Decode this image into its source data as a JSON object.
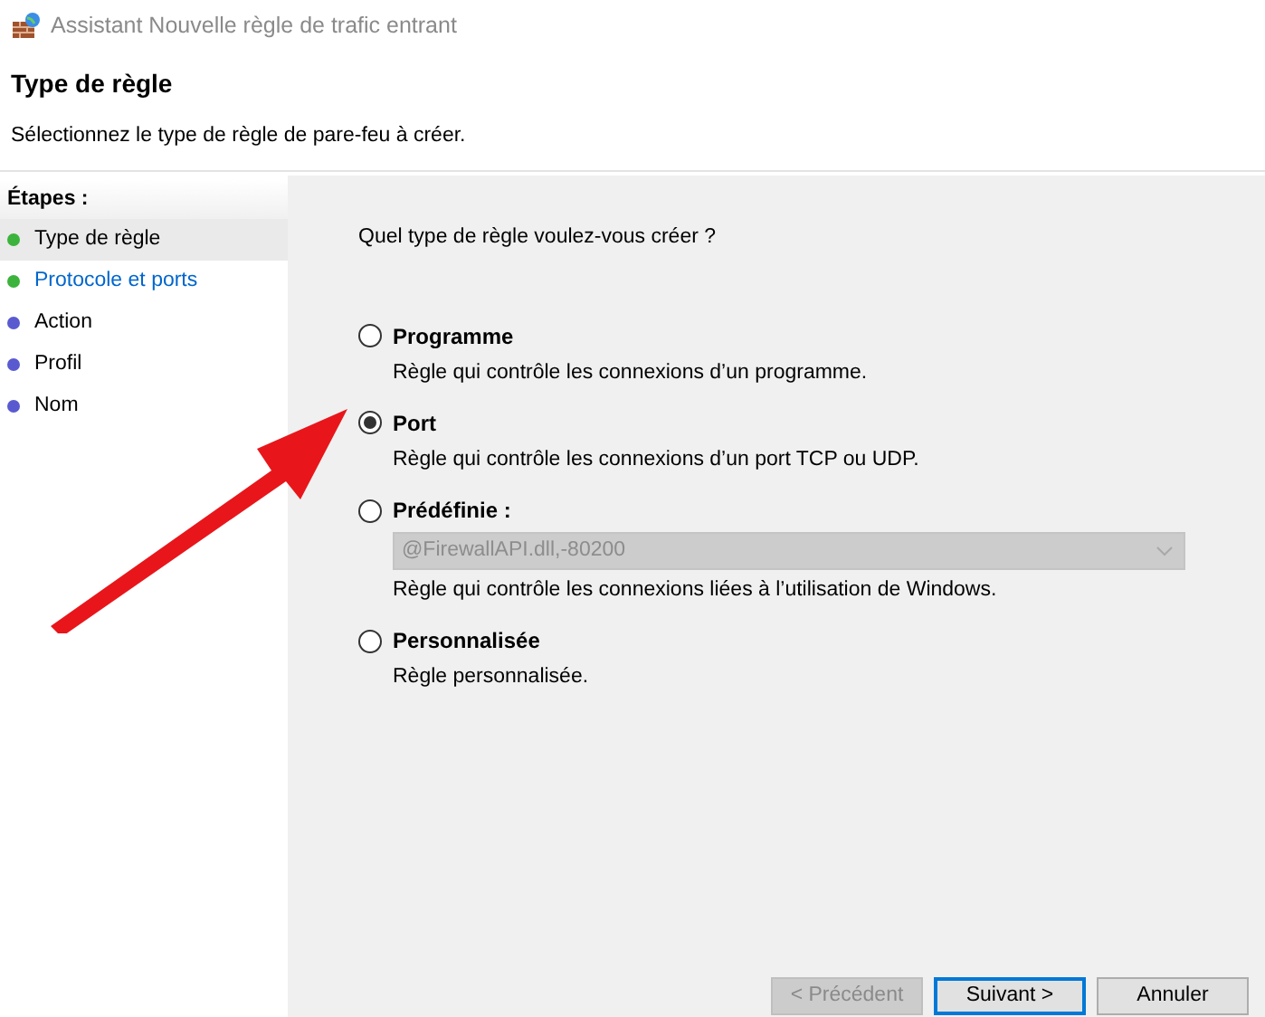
{
  "window": {
    "title": "Assistant Nouvelle règle de trafic entrant"
  },
  "header": {
    "title": "Type de règle",
    "subtitle": "Sélectionnez le type de règle de pare-feu à créer."
  },
  "steps": {
    "heading": "Étapes :",
    "items": [
      {
        "label": "Type de règle",
        "selected": true,
        "kind": "plain",
        "color": "#3cb33c"
      },
      {
        "label": "Protocole et ports",
        "selected": false,
        "kind": "link",
        "color": "#3cb33c"
      },
      {
        "label": "Action",
        "selected": false,
        "kind": "plain",
        "color": "#5a5ad0"
      },
      {
        "label": "Profil",
        "selected": false,
        "kind": "plain",
        "color": "#5a5ad0"
      },
      {
        "label": "Nom",
        "selected": false,
        "kind": "plain",
        "color": "#5a5ad0"
      }
    ]
  },
  "question": "Quel type de règle voulez-vous créer ?",
  "options": [
    {
      "label": "Programme",
      "description": "Règle qui contrôle les connexions d’un programme.",
      "selected": false
    },
    {
      "label": "Port",
      "description": "Règle qui contrôle les connexions d’un port TCP ou UDP.",
      "selected": true
    },
    {
      "label": "Prédéfinie :",
      "description": "Règle qui contrôle les connexions liées à l’utilisation de Windows.",
      "selected": false,
      "dropdown": {
        "value": "@FirewallAPI.dll,-80200",
        "disabled": true
      }
    },
    {
      "label": "Personnalisée",
      "description": "Règle personnalisée.",
      "selected": false
    }
  ],
  "buttons": [
    {
      "label": "< Précédent",
      "disabled": true,
      "default": false
    },
    {
      "label": "Suivant >",
      "disabled": false,
      "default": true
    },
    {
      "label": "Annuler",
      "disabled": false,
      "default": false
    }
  ]
}
